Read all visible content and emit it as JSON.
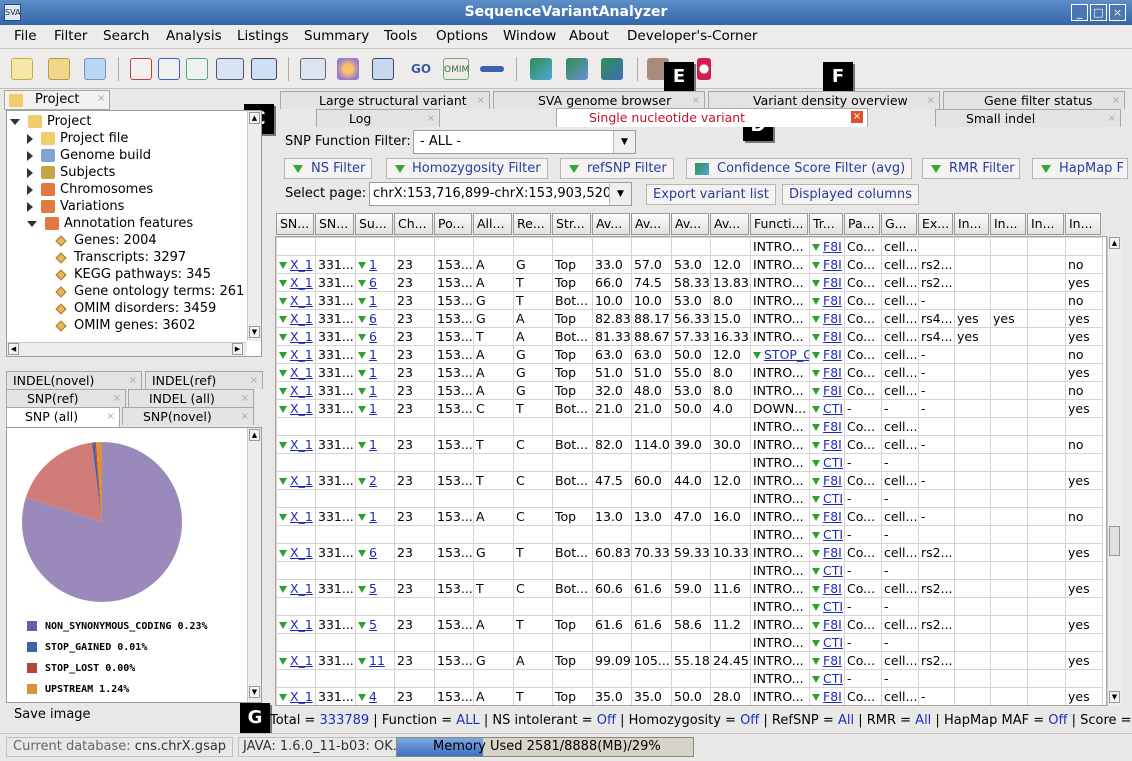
{
  "window": {
    "title": "SequenceVariantAnalyzer",
    "app_icon": "SVA",
    "min": "_",
    "max": "□",
    "close": "×"
  },
  "menu": [
    {
      "label": "File"
    },
    {
      "label": "Filter"
    },
    {
      "label": "Search"
    },
    {
      "label": "Analysis"
    },
    {
      "label": "Listings"
    },
    {
      "label": "Summary"
    },
    {
      "label": "Tools"
    },
    {
      "label": "Options"
    },
    {
      "label": "Window"
    },
    {
      "label": "About"
    },
    {
      "label": "Developer's-Corner"
    }
  ],
  "toolbar": {
    "go": "GO",
    "omim": "OMIM"
  },
  "markers": {
    "a": "A",
    "b": "B",
    "c": "C",
    "d": "D",
    "e": "E",
    "f": "F",
    "g": "G"
  },
  "project_panel": {
    "tab": "Project",
    "tree": [
      {
        "label": "Project",
        "level": 0,
        "icon": "folder"
      },
      {
        "label": "Project file",
        "level": 1,
        "icon": "file"
      },
      {
        "label": "Genome build",
        "level": 1,
        "icon": "gear"
      },
      {
        "label": "Subjects",
        "level": 1,
        "icon": "people"
      },
      {
        "label": "Chromosomes",
        "level": 1,
        "icon": "chromosome"
      },
      {
        "label": "Variations",
        "level": 1,
        "icon": "chromosome"
      },
      {
        "label": "Annotation features",
        "level": 1,
        "icon": "chromosome"
      },
      {
        "label": "Genes: 2004",
        "level": 2
      },
      {
        "label": "Transcripts: 3297",
        "level": 2
      },
      {
        "label": "KEGG pathways: 345",
        "level": 2
      },
      {
        "label": "Gene ontology terms: 261",
        "level": 2
      },
      {
        "label": "OMIM disorders: 3459",
        "level": 2
      },
      {
        "label": "OMIM genes: 3602",
        "level": 2
      }
    ]
  },
  "summary_tabs": {
    "indel_novel": "INDEL(novel)",
    "indel_ref": "INDEL(ref)",
    "snp_ref": "SNP(ref)",
    "indel_all": "INDEL (all)",
    "snp_all": "SNP (all)",
    "snp_novel": "SNP(novel)"
  },
  "chart_data": {
    "type": "pie",
    "slices": [
      {
        "name": "NON_SYNONYMOUS_CODING",
        "label": "NON_SYNONYMOUS_CODING 0.23%",
        "value": 80.0,
        "color": "#9a8abb"
      },
      {
        "name": "SYNONYMOUS",
        "value": 18.0,
        "color": "#d07c78"
      },
      {
        "name": "STOP_GAINED",
        "label": "STOP_GAINED 0.01%",
        "value": 0.5,
        "color": "#3f5fa8"
      },
      {
        "name": "STOP_LOST",
        "label": "STOP_LOST 0.00%",
        "value": 0.3,
        "color": "#b44638"
      },
      {
        "name": "UPSTREAM",
        "label": "UPSTREAM 1.24%",
        "value": 1.2,
        "color": "#e0903a"
      }
    ]
  },
  "save_image": "Save image",
  "top_tabs": {
    "large_sv": "Large structural variant",
    "genome_browser": "SVA genome browser",
    "density": "Variant density overview",
    "gene_filter": "Gene filter status",
    "log": "Log",
    "snv": "Single nucleotide variant",
    "small_indel": "Small indel"
  },
  "function_filter": {
    "label": "SNP Function Filter:",
    "value": "- ALL -"
  },
  "filters": [
    "NS Filter",
    "Homozygosity Filter",
    "refSNP Filter",
    "Confidence Score Filter  (avg)",
    "RMR Filter",
    "HapMap F"
  ],
  "page": {
    "label": "Select page:",
    "value": "chrX:153,716,899-chrX:153,903,520",
    "export": "Export variant list",
    "columns": "Displayed columns"
  },
  "columns": [
    "SN...",
    "SN...",
    "Su...",
    "Ch...",
    "Po...",
    "All...",
    "Re...",
    "Str...",
    "Av...",
    "Av...",
    "Av...",
    "Av...",
    "Functi...",
    "Tr...",
    "Pa...",
    "G...",
    "Ex...",
    "In...",
    "In...",
    "In...",
    "In..."
  ],
  "rows": [
    [
      "",
      "",
      "",
      "",
      "",
      "",
      "",
      "",
      "",
      "",
      "",
      "",
      "INTRO...",
      "▼F8I",
      "Co...",
      "cell...",
      "",
      "",
      "",
      "",
      ""
    ],
    [
      "X_1",
      "331...",
      "1",
      "23",
      "153...",
      "A",
      "G",
      "Top",
      "33.0",
      "57.0",
      "53.0",
      "12.0",
      "INTRO...",
      "F8I",
      "Co...",
      "cell...",
      "rs2...",
      "",
      "",
      "",
      "no"
    ],
    [
      "X_1",
      "331...",
      "6",
      "23",
      "153...",
      "A",
      "T",
      "Top",
      "66.0",
      "74.5",
      "58.33",
      "13.83",
      "INTRO...",
      "F8I",
      "Co...",
      "cell...",
      "rs2...",
      "",
      "",
      "",
      "yes"
    ],
    [
      "X_1",
      "331...",
      "1",
      "23",
      "153...",
      "G",
      "T",
      "Bot...",
      "10.0",
      "10.0",
      "53.0",
      "8.0",
      "INTRO...",
      "F8I",
      "Co...",
      "cell...",
      "-",
      "",
      "",
      "",
      "no"
    ],
    [
      "X_1",
      "331...",
      "6",
      "23",
      "153...",
      "G",
      "A",
      "Top",
      "82.83",
      "88.17",
      "56.33",
      "15.0",
      "INTRO...",
      "F8I",
      "Co...",
      "cell...",
      "rs4...",
      "yes",
      "yes",
      "",
      "yes"
    ],
    [
      "X_1",
      "331...",
      "6",
      "23",
      "153...",
      "T",
      "A",
      "Bot...",
      "81.33",
      "88.67",
      "57.33",
      "16.33",
      "INTRO...",
      "F8I",
      "Co...",
      "cell...",
      "rs4...",
      "yes",
      "",
      "",
      "yes"
    ],
    [
      "X_1",
      "331...",
      "1",
      "23",
      "153...",
      "A",
      "G",
      "Top",
      "63.0",
      "63.0",
      "50.0",
      "12.0",
      "STOP_G",
      "F8I",
      "Co...",
      "cell...",
      "-",
      "",
      "",
      "",
      "no"
    ],
    [
      "X_1",
      "331...",
      "1",
      "23",
      "153...",
      "A",
      "G",
      "Top",
      "51.0",
      "51.0",
      "55.0",
      "8.0",
      "INTRO...",
      "F8I",
      "Co...",
      "cell...",
      "-",
      "",
      "",
      "",
      "yes"
    ],
    [
      "X_1",
      "331...",
      "1",
      "23",
      "153...",
      "A",
      "G",
      "Top",
      "32.0",
      "48.0",
      "53.0",
      "8.0",
      "INTRO...",
      "F8I",
      "Co...",
      "cell...",
      "-",
      "",
      "",
      "",
      "no"
    ],
    [
      "X_1",
      "331...",
      "1",
      "23",
      "153...",
      "C",
      "T",
      "Bot...",
      "21.0",
      "21.0",
      "50.0",
      "4.0",
      "DOWN...",
      "CTI",
      "-",
      "-",
      "-",
      "",
      "",
      "",
      "yes"
    ],
    [
      "",
      "",
      "",
      "",
      "",
      "",
      "",
      "",
      "",
      "",
      "",
      "",
      "INTRO...",
      "F8I",
      "Co...",
      "cell...",
      "",
      "",
      "",
      "",
      ""
    ],
    [
      "X_1",
      "331...",
      "1",
      "23",
      "153...",
      "T",
      "C",
      "Bot...",
      "82.0",
      "114.0",
      "39.0",
      "30.0",
      "INTRO...",
      "F8I",
      "Co...",
      "cell...",
      "-",
      "",
      "",
      "",
      "no"
    ],
    [
      "",
      "",
      "",
      "",
      "",
      "",
      "",
      "",
      "",
      "",
      "",
      "",
      "INTRO...",
      "CTI",
      "-",
      "-",
      "",
      "",
      "",
      "",
      ""
    ],
    [
      "X_1",
      "331...",
      "2",
      "23",
      "153...",
      "T",
      "C",
      "Bot...",
      "47.5",
      "60.0",
      "44.0",
      "12.0",
      "INTRO...",
      "F8I",
      "Co...",
      "cell...",
      "-",
      "",
      "",
      "",
      "yes"
    ],
    [
      "",
      "",
      "",
      "",
      "",
      "",
      "",
      "",
      "",
      "",
      "",
      "",
      "INTRO...",
      "CTI",
      "-",
      "-",
      "",
      "",
      "",
      "",
      ""
    ],
    [
      "X_1",
      "331...",
      "1",
      "23",
      "153...",
      "A",
      "C",
      "Top",
      "13.0",
      "13.0",
      "47.0",
      "16.0",
      "INTRO...",
      "F8I",
      "Co...",
      "cell...",
      "-",
      "",
      "",
      "",
      "no"
    ],
    [
      "",
      "",
      "",
      "",
      "",
      "",
      "",
      "",
      "",
      "",
      "",
      "",
      "INTRO...",
      "CTI",
      "-",
      "-",
      "",
      "",
      "",
      "",
      ""
    ],
    [
      "X_1",
      "331...",
      "6",
      "23",
      "153...",
      "G",
      "T",
      "Bot...",
      "60.83",
      "70.33",
      "59.33",
      "10.33",
      "INTRO...",
      "F8I",
      "Co...",
      "cell...",
      "rs2...",
      "",
      "",
      "",
      "yes"
    ],
    [
      "",
      "",
      "",
      "",
      "",
      "",
      "",
      "",
      "",
      "",
      "",
      "",
      "INTRO...",
      "CTI",
      "-",
      "-",
      "",
      "",
      "",
      "",
      ""
    ],
    [
      "X_1",
      "331...",
      "5",
      "23",
      "153...",
      "T",
      "C",
      "Bot...",
      "60.6",
      "61.6",
      "59.0",
      "11.6",
      "INTRO...",
      "F8I",
      "Co...",
      "cell...",
      "rs2...",
      "",
      "",
      "",
      "yes"
    ],
    [
      "",
      "",
      "",
      "",
      "",
      "",
      "",
      "",
      "",
      "",
      "",
      "",
      "INTRO...",
      "CTI",
      "-",
      "-",
      "",
      "",
      "",
      "",
      ""
    ],
    [
      "X_1",
      "331...",
      "5",
      "23",
      "153...",
      "A",
      "T",
      "Top",
      "61.6",
      "61.6",
      "58.6",
      "11.2",
      "INTRO...",
      "F8I",
      "Co...",
      "cell...",
      "rs2...",
      "",
      "",
      "",
      "yes"
    ],
    [
      "",
      "",
      "",
      "",
      "",
      "",
      "",
      "",
      "",
      "",
      "",
      "",
      "INTRO...",
      "CTI",
      "-",
      "-",
      "",
      "",
      "",
      "",
      ""
    ],
    [
      "X_1",
      "331...",
      "11",
      "23",
      "153...",
      "G",
      "A",
      "Top",
      "99.09",
      "105...",
      "55.18",
      "24.45",
      "INTRO...",
      "F8I",
      "Co...",
      "cell...",
      "rs2...",
      "",
      "",
      "",
      "yes"
    ],
    [
      "",
      "",
      "",
      "",
      "",
      "",
      "",
      "",
      "",
      "",
      "",
      "",
      "INTRO...",
      "CTI",
      "-",
      "-",
      "",
      "",
      "",
      "",
      ""
    ],
    [
      "X_1",
      "331...",
      "4",
      "23",
      "153...",
      "A",
      "T",
      "Top",
      "35.0",
      "35.0",
      "50.0",
      "28.0",
      "INTRO...",
      "F8I",
      "Co...",
      "cell...",
      "-",
      "",
      "",
      "",
      "yes"
    ]
  ],
  "status": {
    "total_label": "Total =",
    "total": "333789",
    "function_label": "Function =",
    "function": "ALL",
    "ns_label": "NS intolerant =",
    "ns": "Off",
    "homo_label": "Homozygosity =",
    "homo": "Off",
    "refsnp_label": "RefSNP =",
    "refsnp": "All",
    "rmr_label": "RMR =",
    "rmr": "All",
    "hapmap_label": "HapMap MAF =",
    "hapmap": "Off",
    "score_label": "Score =",
    "score": "("
  },
  "bottom": {
    "db_label": "Current database:",
    "db": "cns.chrX.gsap",
    "java": "JAVA: 1.6.0_11-b03: OK.",
    "memory": "Memory Used 2581/8888(MB)/29%",
    "memory_fraction": 0.29
  }
}
